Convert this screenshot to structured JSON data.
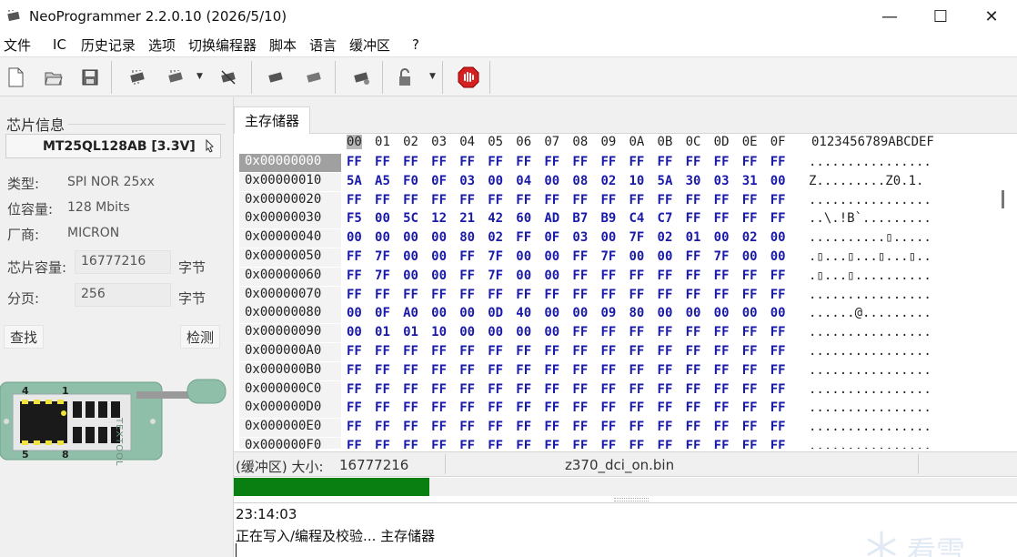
{
  "window": {
    "title": "NeoProgrammer 2.2.0.10 (2026/5/10)",
    "minimize": "—",
    "maximize": "☐",
    "close": "✕"
  },
  "menu": [
    "文件",
    "IC",
    "历史记录",
    "选项",
    "切换编程器",
    "脚本",
    "语言",
    "缓冲区",
    "?"
  ],
  "toolbar": {
    "buttons": [
      "new-file-icon",
      "open-file-icon",
      "save-icon",
      "read-chip-icon",
      "write-chip-icon",
      "erase-chip-icon",
      "verify-chip-icon",
      "blank-check-icon",
      "auto-program-icon",
      "lock-icon",
      "stop-icon"
    ]
  },
  "chip_info": {
    "section_title": "芯片信息",
    "chip_name": "MT25QL128AB [3.3V]",
    "type_label": "类型:",
    "type_value": "SPI NOR 25xx",
    "bits_label": "位容量:",
    "bits_value": "128 Mbits",
    "vendor_label": "厂商:",
    "vendor_value": "MICRON",
    "size_label": "芯片容量:",
    "size_value": "16777216",
    "size_unit": "字节",
    "page_label": "分页:",
    "page_value": "256",
    "page_unit": "字节",
    "find_button": "查找",
    "detect_button": "检测"
  },
  "socket": {
    "pin_top_left": "4",
    "pin_top_right": "1",
    "pin_bottom_left": "5",
    "pin_bottom_right": "8",
    "brand": "TEXTOOL"
  },
  "tab": {
    "label": "主存储器"
  },
  "hex": {
    "header": [
      "00",
      "01",
      "02",
      "03",
      "04",
      "05",
      "06",
      "07",
      "08",
      "09",
      "0A",
      "0B",
      "0C",
      "0D",
      "0E",
      "0F"
    ],
    "ascii_header": "0123456789ABCDEF",
    "rows": [
      {
        "addr": "0x00000000",
        "bytes": [
          "FF",
          "FF",
          "FF",
          "FF",
          "FF",
          "FF",
          "FF",
          "FF",
          "FF",
          "FF",
          "FF",
          "FF",
          "FF",
          "FF",
          "FF",
          "FF"
        ],
        "ascii": "................"
      },
      {
        "addr": "0x00000010",
        "bytes": [
          "5A",
          "A5",
          "F0",
          "0F",
          "03",
          "00",
          "04",
          "00",
          "08",
          "02",
          "10",
          "5A",
          "30",
          "03",
          "31",
          "00"
        ],
        "ascii": "Z.........Z0.1."
      },
      {
        "addr": "0x00000020",
        "bytes": [
          "FF",
          "FF",
          "FF",
          "FF",
          "FF",
          "FF",
          "FF",
          "FF",
          "FF",
          "FF",
          "FF",
          "FF",
          "FF",
          "FF",
          "FF",
          "FF"
        ],
        "ascii": "................"
      },
      {
        "addr": "0x00000030",
        "bytes": [
          "F5",
          "00",
          "5C",
          "12",
          "21",
          "42",
          "60",
          "AD",
          "B7",
          "B9",
          "C4",
          "C7",
          "FF",
          "FF",
          "FF",
          "FF"
        ],
        "ascii": "..\\.!B`........."
      },
      {
        "addr": "0x00000040",
        "bytes": [
          "00",
          "00",
          "00",
          "00",
          "80",
          "02",
          "FF",
          "0F",
          "03",
          "00",
          "7F",
          "02",
          "01",
          "00",
          "02",
          "00"
        ],
        "ascii": "..........▯....."
      },
      {
        "addr": "0x00000050",
        "bytes": [
          "FF",
          "7F",
          "00",
          "00",
          "FF",
          "7F",
          "00",
          "00",
          "FF",
          "7F",
          "00",
          "00",
          "FF",
          "7F",
          "00",
          "00"
        ],
        "ascii": ".▯...▯...▯...▯.."
      },
      {
        "addr": "0x00000060",
        "bytes": [
          "FF",
          "7F",
          "00",
          "00",
          "FF",
          "7F",
          "00",
          "00",
          "FF",
          "FF",
          "FF",
          "FF",
          "FF",
          "FF",
          "FF",
          "FF"
        ],
        "ascii": ".▯...▯.........."
      },
      {
        "addr": "0x00000070",
        "bytes": [
          "FF",
          "FF",
          "FF",
          "FF",
          "FF",
          "FF",
          "FF",
          "FF",
          "FF",
          "FF",
          "FF",
          "FF",
          "FF",
          "FF",
          "FF",
          "FF"
        ],
        "ascii": "................"
      },
      {
        "addr": "0x00000080",
        "bytes": [
          "00",
          "0F",
          "A0",
          "00",
          "00",
          "0D",
          "40",
          "00",
          "00",
          "09",
          "80",
          "00",
          "00",
          "00",
          "00",
          "00"
        ],
        "ascii": "......@........."
      },
      {
        "addr": "0x00000090",
        "bytes": [
          "00",
          "01",
          "01",
          "10",
          "00",
          "00",
          "00",
          "00",
          "FF",
          "FF",
          "FF",
          "FF",
          "FF",
          "FF",
          "FF",
          "FF"
        ],
        "ascii": "................"
      },
      {
        "addr": "0x000000A0",
        "bytes": [
          "FF",
          "FF",
          "FF",
          "FF",
          "FF",
          "FF",
          "FF",
          "FF",
          "FF",
          "FF",
          "FF",
          "FF",
          "FF",
          "FF",
          "FF",
          "FF"
        ],
        "ascii": "................"
      },
      {
        "addr": "0x000000B0",
        "bytes": [
          "FF",
          "FF",
          "FF",
          "FF",
          "FF",
          "FF",
          "FF",
          "FF",
          "FF",
          "FF",
          "FF",
          "FF",
          "FF",
          "FF",
          "FF",
          "FF"
        ],
        "ascii": "................"
      },
      {
        "addr": "0x000000C0",
        "bytes": [
          "FF",
          "FF",
          "FF",
          "FF",
          "FF",
          "FF",
          "FF",
          "FF",
          "FF",
          "FF",
          "FF",
          "FF",
          "FF",
          "FF",
          "FF",
          "FF"
        ],
        "ascii": "................"
      },
      {
        "addr": "0x000000D0",
        "bytes": [
          "FF",
          "FF",
          "FF",
          "FF",
          "FF",
          "FF",
          "FF",
          "FF",
          "FF",
          "FF",
          "FF",
          "FF",
          "FF",
          "FF",
          "FF",
          "FF"
        ],
        "ascii": "................"
      },
      {
        "addr": "0x000000E0",
        "bytes": [
          "FF",
          "FF",
          "FF",
          "FF",
          "FF",
          "FF",
          "FF",
          "FF",
          "FF",
          "FF",
          "FF",
          "FF",
          "FF",
          "FF",
          "FF",
          "FF"
        ],
        "ascii": "................"
      },
      {
        "addr": "0x000000F0",
        "bytes": [
          "FF",
          "FF",
          "FF",
          "FF",
          "FF",
          "FF",
          "FF",
          "FF",
          "FF",
          "FF",
          "FF",
          "FF",
          "FF",
          "FF",
          "FF",
          "FF"
        ],
        "ascii": "................"
      }
    ]
  },
  "buffer": {
    "label": "(缓冲区) 大小:",
    "size": "16777216",
    "filename": "z370_dci_on.bin"
  },
  "progress": {
    "fraction": 0.249
  },
  "log": {
    "time": "23:14:03",
    "message": "正在写入/编程及校验... 主存储器"
  },
  "watermark": {
    "text": "看雪"
  }
}
